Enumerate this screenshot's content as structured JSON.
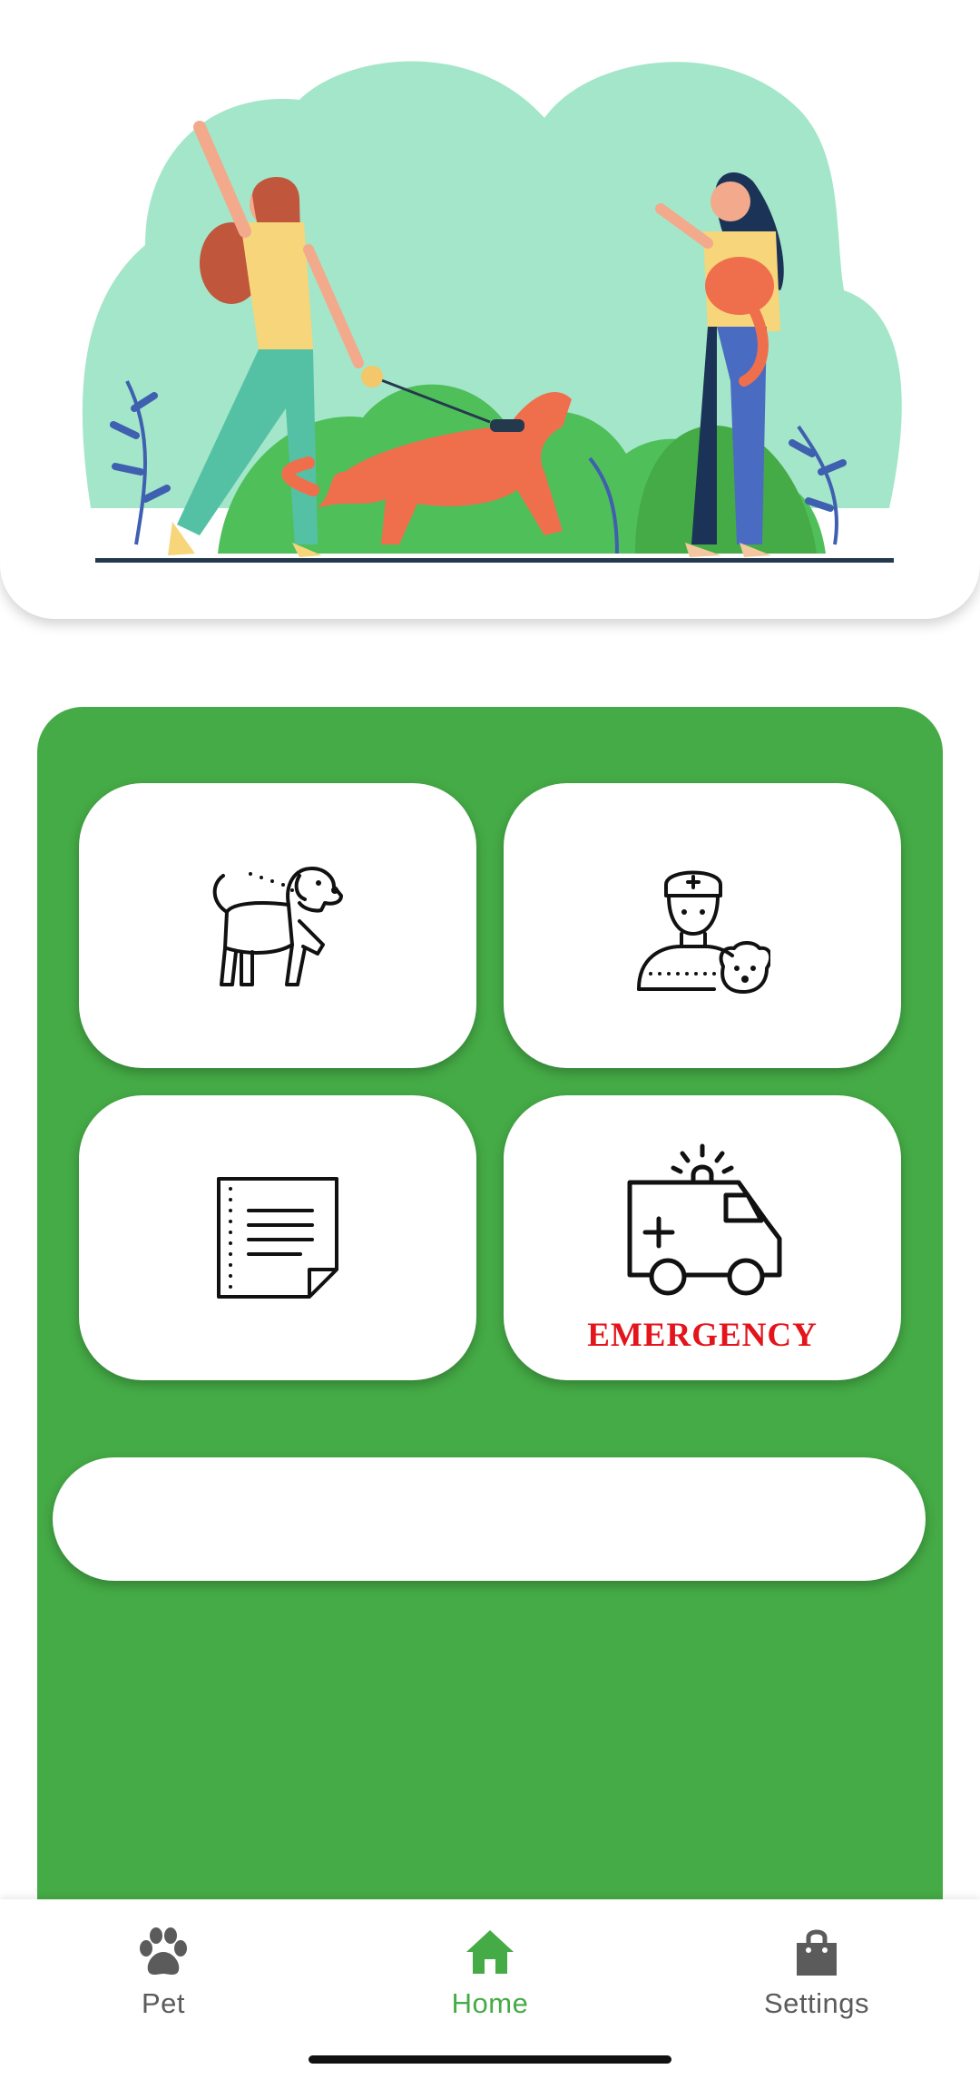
{
  "hero": {
    "illustration": "two women walking a dog and holding a cat"
  },
  "services": [
    {
      "id": "walk",
      "icon": "dog-walking-icon",
      "label": ""
    },
    {
      "id": "vet",
      "icon": "veterinarian-icon",
      "label": ""
    },
    {
      "id": "records",
      "icon": "document-icon",
      "label": ""
    },
    {
      "id": "emergency",
      "icon": "ambulance-icon",
      "label": "EMERGENCY"
    }
  ],
  "banner": {
    "text": ""
  },
  "nav": {
    "items": [
      {
        "label": "Pet",
        "icon": "paw-icon",
        "active": false
      },
      {
        "label": "Home",
        "icon": "home-icon",
        "active": true
      },
      {
        "label": "Settings",
        "icon": "shopping-bag-icon",
        "active": false
      }
    ]
  },
  "colors": {
    "accent": "#45ab46",
    "emergency": "#e3141b",
    "hero_bg": "#a4e6c9"
  }
}
